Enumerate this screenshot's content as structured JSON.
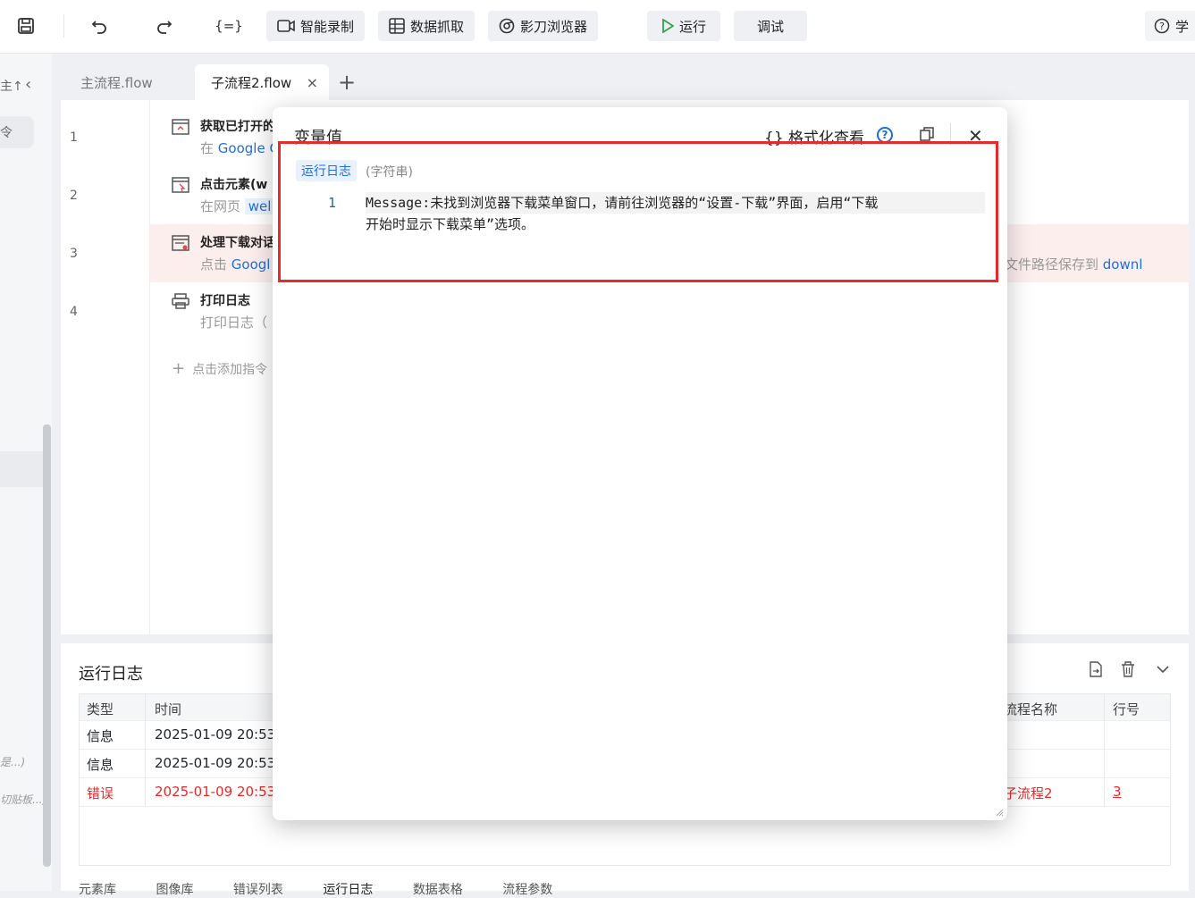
{
  "toolbar": {
    "record": "智能录制",
    "scrape": "数据抓取",
    "browser": "影刀浏览器",
    "run": "运行",
    "debug": "调试",
    "learn": "学"
  },
  "sidebar": {
    "cut_text": "主↑",
    "nav_text": "令",
    "hint1": "是...)",
    "hint2": "切贴板...)"
  },
  "tabs": [
    {
      "label": "主流程.flow"
    },
    {
      "label": "子流程2.flow"
    }
  ],
  "steps": [
    {
      "num": "1",
      "title": "获取已打开的",
      "sub_prefix": "在 ",
      "sub_link": "Google C"
    },
    {
      "num": "2",
      "title": "点击元素(w",
      "sub_prefix": "在网页 ",
      "sub_link": "wel"
    },
    {
      "num": "3",
      "title": "处理下载对话",
      "sub_prefix": "点击 ",
      "sub_link": "Googl",
      "sub_right": "文件路径保存到 ",
      "sub_right_link": "downl"
    },
    {
      "num": "4",
      "title": "打印日志",
      "sub_prefix": "打印日志（",
      "sub_link": ""
    }
  ],
  "add_step": "点击添加指令",
  "log": {
    "title": "运行日志",
    "headers": {
      "type": "类型",
      "time": "时间",
      "flow": "流程名称",
      "line": "行号"
    },
    "rows": [
      {
        "type": "信息",
        "time": "2025-01-09 20:53:",
        "flow": "",
        "line": ""
      },
      {
        "type": "信息",
        "time": "2025-01-09 20:53:",
        "flow": "",
        "line": ""
      },
      {
        "type": "错误",
        "time": "2025-01-09 20:53:",
        "flow": "子流程2",
        "line": "3"
      }
    ],
    "bottom_tabs": [
      "元素库",
      "图像库",
      "错误列表",
      "运行日志",
      "数据表格",
      "流程参数"
    ]
  },
  "dialog": {
    "title": "变量值",
    "format": "{} 格式化查看",
    "var_name": "运行日志",
    "var_type": "(字符串)",
    "line_no": "1",
    "message_line1": "Message:未找到浏览器下载菜单窗口，请前往浏览器的“设置-下载”界面，启用“下载",
    "message_line2": "开始时显示下载菜单”选项。"
  },
  "colors": {
    "accent": "#1e6fd9",
    "error": "#e52b2b",
    "error_row": "#fdeeee",
    "run_green": "#2ea44f"
  }
}
